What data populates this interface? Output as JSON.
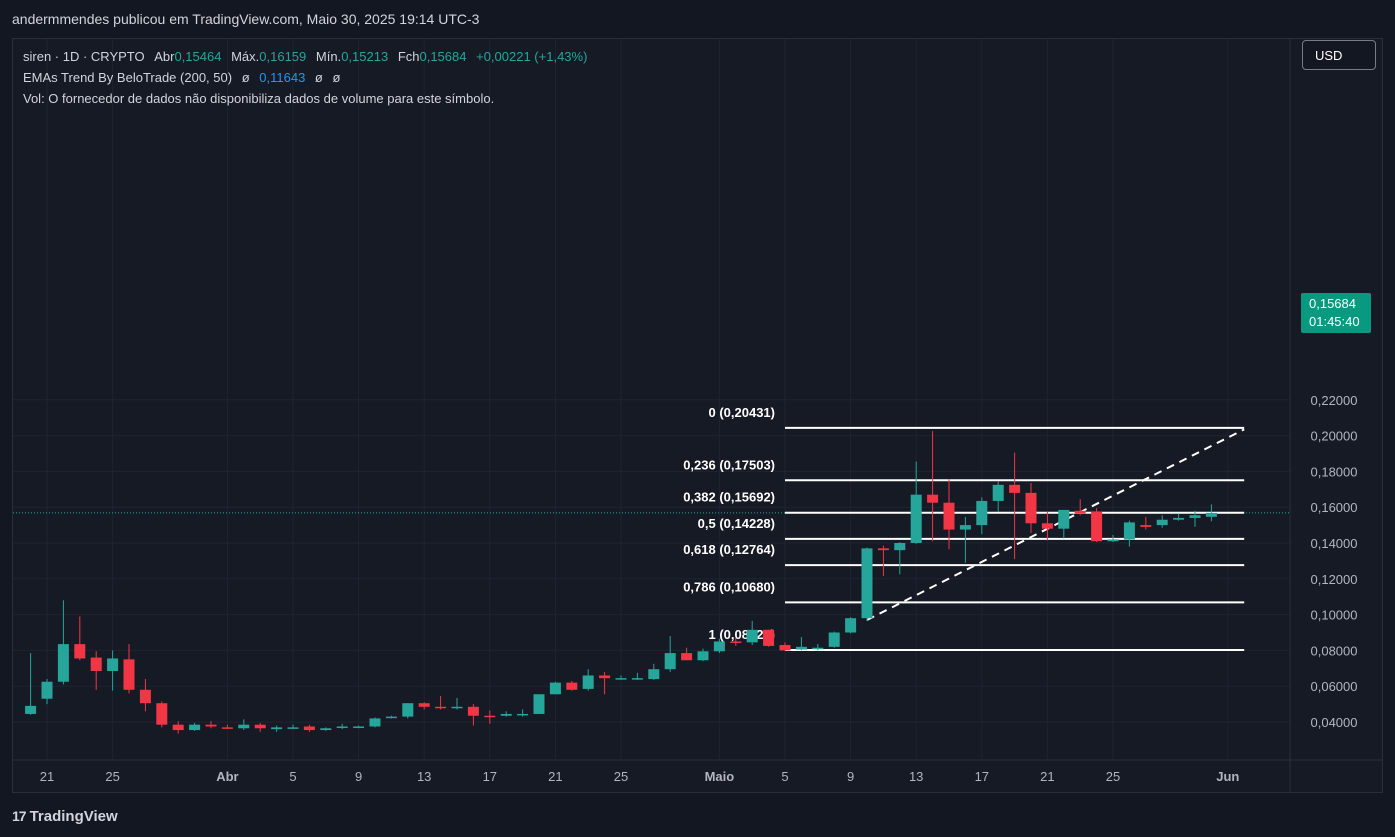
{
  "header": {
    "published_text": "andermmendes publicou em TradingView.com, Maio 30, 2025 19:14 UTC-3"
  },
  "legend": {
    "symbol": "siren · 1D · CRYPTO",
    "open_label": "Abr",
    "open": "0,15464",
    "high_label": "Máx.",
    "high": "0,16159",
    "low_label": "Mín.",
    "low": "0,15213",
    "close_label": "Fch",
    "close": "0,15684",
    "change": "+0,00221 (+1,43%)",
    "indicator_name": "EMAs Trend By BeloTrade (200, 50)",
    "indicator_null_1": "ø",
    "indicator_value": "0,11643",
    "indicator_null_2": "ø",
    "indicator_null_3": "ø",
    "volume_note": "Vol: O fornecedor de dados não disponibiliza dados de volume para este símbolo."
  },
  "currency_button": "USD",
  "price_badge": {
    "price": "0,15684",
    "countdown": "01:45:40"
  },
  "footer": {
    "logo_mark": "17",
    "logo_text": "TradingView"
  },
  "colors": {
    "background": "#161a25",
    "up": "#26a69a",
    "down": "#f23645",
    "grid": "#1f2430",
    "axis_text": "#b2b5be",
    "fib_line": "#ffffff"
  },
  "chart_data": {
    "type": "candlestick",
    "y_axis": {
      "range": [
        0.032,
        0.224
      ],
      "ticks": [
        "0,04000",
        "0,06000",
        "0,08000",
        "0,10000",
        "0,12000",
        "0,14000",
        "0,16000",
        "0,18000",
        "0,20000",
        "0,22000"
      ],
      "tick_values": [
        0.04,
        0.06,
        0.08,
        0.1,
        0.12,
        0.14,
        0.16,
        0.18,
        0.2,
        0.22
      ]
    },
    "x_axis": {
      "ticks": [
        "21",
        "25",
        "Abr",
        "5",
        "9",
        "13",
        "17",
        "21",
        "25",
        "Maio",
        "5",
        "9",
        "13",
        "17",
        "21",
        "25",
        "Jun"
      ],
      "tick_dates": [
        "2025-03-21",
        "2025-03-25",
        "2025-04-01",
        "2025-04-05",
        "2025-04-09",
        "2025-04-13",
        "2025-04-17",
        "2025-04-21",
        "2025-04-25",
        "2025-05-01",
        "2025-05-05",
        "2025-05-09",
        "2025-05-13",
        "2025-05-17",
        "2025-05-21",
        "2025-05-25",
        "2025-06-01"
      ]
    },
    "candles": [
      {
        "date": "2025-03-20",
        "o": 0.0445,
        "h": 0.0785,
        "l": 0.044,
        "c": 0.049
      },
      {
        "date": "2025-03-21",
        "o": 0.053,
        "h": 0.064,
        "l": 0.05,
        "c": 0.0625
      },
      {
        "date": "2025-03-22",
        "o": 0.0625,
        "h": 0.108,
        "l": 0.061,
        "c": 0.0835
      },
      {
        "date": "2025-03-23",
        "o": 0.0835,
        "h": 0.099,
        "l": 0.0745,
        "c": 0.0755
      },
      {
        "date": "2025-03-24",
        "o": 0.076,
        "h": 0.0795,
        "l": 0.058,
        "c": 0.0685
      },
      {
        "date": "2025-03-25",
        "o": 0.0685,
        "h": 0.08,
        "l": 0.0575,
        "c": 0.0755
      },
      {
        "date": "2025-03-26",
        "o": 0.075,
        "h": 0.0835,
        "l": 0.056,
        "c": 0.058
      },
      {
        "date": "2025-03-27",
        "o": 0.058,
        "h": 0.064,
        "l": 0.046,
        "c": 0.0505
      },
      {
        "date": "2025-03-28",
        "o": 0.0505,
        "h": 0.0515,
        "l": 0.037,
        "c": 0.0385
      },
      {
        "date": "2025-03-29",
        "o": 0.0385,
        "h": 0.0405,
        "l": 0.0335,
        "c": 0.0355
      },
      {
        "date": "2025-03-30",
        "o": 0.0355,
        "h": 0.0395,
        "l": 0.035,
        "c": 0.0385
      },
      {
        "date": "2025-03-31",
        "o": 0.0385,
        "h": 0.0405,
        "l": 0.0365,
        "c": 0.0375
      },
      {
        "date": "2025-04-01",
        "o": 0.037,
        "h": 0.0385,
        "l": 0.0365,
        "c": 0.0365
      },
      {
        "date": "2025-04-02",
        "o": 0.0365,
        "h": 0.0415,
        "l": 0.0355,
        "c": 0.0385
      },
      {
        "date": "2025-04-03",
        "o": 0.0385,
        "h": 0.0395,
        "l": 0.0345,
        "c": 0.0365
      },
      {
        "date": "2025-04-04",
        "o": 0.036,
        "h": 0.038,
        "l": 0.0345,
        "c": 0.037
      },
      {
        "date": "2025-04-05",
        "o": 0.037,
        "h": 0.0385,
        "l": 0.0365,
        "c": 0.037
      },
      {
        "date": "2025-04-06",
        "o": 0.0375,
        "h": 0.0385,
        "l": 0.0345,
        "c": 0.0355
      },
      {
        "date": "2025-04-07",
        "o": 0.0355,
        "h": 0.037,
        "l": 0.035,
        "c": 0.0365
      },
      {
        "date": "2025-04-08",
        "o": 0.037,
        "h": 0.039,
        "l": 0.036,
        "c": 0.0375
      },
      {
        "date": "2025-04-09",
        "o": 0.0375,
        "h": 0.038,
        "l": 0.0365,
        "c": 0.0375
      },
      {
        "date": "2025-04-10",
        "o": 0.0375,
        "h": 0.0425,
        "l": 0.037,
        "c": 0.042
      },
      {
        "date": "2025-04-11",
        "o": 0.0425,
        "h": 0.0435,
        "l": 0.042,
        "c": 0.043
      },
      {
        "date": "2025-04-12",
        "o": 0.043,
        "h": 0.0505,
        "l": 0.042,
        "c": 0.0505
      },
      {
        "date": "2025-04-13",
        "o": 0.0505,
        "h": 0.051,
        "l": 0.047,
        "c": 0.0485
      },
      {
        "date": "2025-04-14",
        "o": 0.0485,
        "h": 0.0545,
        "l": 0.047,
        "c": 0.048
      },
      {
        "date": "2025-04-15",
        "o": 0.048,
        "h": 0.0535,
        "l": 0.047,
        "c": 0.0485
      },
      {
        "date": "2025-04-16",
        "o": 0.0485,
        "h": 0.05,
        "l": 0.038,
        "c": 0.0435
      },
      {
        "date": "2025-04-17",
        "o": 0.0435,
        "h": 0.0465,
        "l": 0.039,
        "c": 0.043
      },
      {
        "date": "2025-04-18",
        "o": 0.0435,
        "h": 0.046,
        "l": 0.043,
        "c": 0.0445
      },
      {
        "date": "2025-04-19",
        "o": 0.0445,
        "h": 0.047,
        "l": 0.043,
        "c": 0.0445
      },
      {
        "date": "2025-04-20",
        "o": 0.0445,
        "h": 0.0555,
        "l": 0.0445,
        "c": 0.0555
      },
      {
        "date": "2025-04-21",
        "o": 0.0555,
        "h": 0.0625,
        "l": 0.0555,
        "c": 0.062
      },
      {
        "date": "2025-04-22",
        "o": 0.062,
        "h": 0.063,
        "l": 0.0575,
        "c": 0.058
      },
      {
        "date": "2025-04-23",
        "o": 0.0585,
        "h": 0.0695,
        "l": 0.0575,
        "c": 0.066
      },
      {
        "date": "2025-04-24",
        "o": 0.066,
        "h": 0.068,
        "l": 0.0555,
        "c": 0.0645
      },
      {
        "date": "2025-04-25",
        "o": 0.0645,
        "h": 0.066,
        "l": 0.0635,
        "c": 0.0645
      },
      {
        "date": "2025-04-26",
        "o": 0.0645,
        "h": 0.0675,
        "l": 0.0635,
        "c": 0.0645
      },
      {
        "date": "2025-04-27",
        "o": 0.064,
        "h": 0.0725,
        "l": 0.0635,
        "c": 0.0695
      },
      {
        "date": "2025-04-28",
        "o": 0.0695,
        "h": 0.088,
        "l": 0.068,
        "c": 0.0785
      },
      {
        "date": "2025-04-29",
        "o": 0.0785,
        "h": 0.0815,
        "l": 0.0745,
        "c": 0.0745
      },
      {
        "date": "2025-04-30",
        "o": 0.0745,
        "h": 0.081,
        "l": 0.074,
        "c": 0.0795
      },
      {
        "date": "2025-05-01",
        "o": 0.0795,
        "h": 0.0865,
        "l": 0.0785,
        "c": 0.085
      },
      {
        "date": "2025-05-02",
        "o": 0.085,
        "h": 0.087,
        "l": 0.0825,
        "c": 0.0845
      },
      {
        "date": "2025-05-03",
        "o": 0.0845,
        "h": 0.0965,
        "l": 0.083,
        "c": 0.0915
      },
      {
        "date": "2025-05-04",
        "o": 0.0915,
        "h": 0.0915,
        "l": 0.082,
        "c": 0.0825
      },
      {
        "date": "2025-05-05",
        "o": 0.083,
        "h": 0.0845,
        "l": 0.0795,
        "c": 0.08
      },
      {
        "date": "2025-05-06",
        "o": 0.0805,
        "h": 0.0875,
        "l": 0.08,
        "c": 0.082
      },
      {
        "date": "2025-05-07",
        "o": 0.081,
        "h": 0.0835,
        "l": 0.08,
        "c": 0.0815
      },
      {
        "date": "2025-05-08",
        "o": 0.082,
        "h": 0.0905,
        "l": 0.0815,
        "c": 0.09
      },
      {
        "date": "2025-05-09",
        "o": 0.09,
        "h": 0.0985,
        "l": 0.0895,
        "c": 0.098
      },
      {
        "date": "2025-05-10",
        "o": 0.098,
        "h": 0.1375,
        "l": 0.0965,
        "c": 0.137
      },
      {
        "date": "2025-05-11",
        "o": 0.137,
        "h": 0.1385,
        "l": 0.1215,
        "c": 0.136
      },
      {
        "date": "2025-05-12",
        "o": 0.136,
        "h": 0.1405,
        "l": 0.1225,
        "c": 0.14
      },
      {
        "date": "2025-05-13",
        "o": 0.14,
        "h": 0.1855,
        "l": 0.1395,
        "c": 0.167
      },
      {
        "date": "2025-05-14",
        "o": 0.167,
        "h": 0.2025,
        "l": 0.141,
        "c": 0.1625
      },
      {
        "date": "2025-05-15",
        "o": 0.1625,
        "h": 0.1755,
        "l": 0.1365,
        "c": 0.1475
      },
      {
        "date": "2025-05-16",
        "o": 0.1475,
        "h": 0.1545,
        "l": 0.129,
        "c": 0.15
      },
      {
        "date": "2025-05-17",
        "o": 0.15,
        "h": 0.1655,
        "l": 0.145,
        "c": 0.1635
      },
      {
        "date": "2025-05-18",
        "o": 0.1635,
        "h": 0.1745,
        "l": 0.1575,
        "c": 0.1725
      },
      {
        "date": "2025-05-19",
        "o": 0.1725,
        "h": 0.1905,
        "l": 0.131,
        "c": 0.168
      },
      {
        "date": "2025-05-20",
        "o": 0.168,
        "h": 0.1735,
        "l": 0.1455,
        "c": 0.151
      },
      {
        "date": "2025-05-21",
        "o": 0.151,
        "h": 0.1575,
        "l": 0.1415,
        "c": 0.148
      },
      {
        "date": "2025-05-22",
        "o": 0.148,
        "h": 0.158,
        "l": 0.1425,
        "c": 0.1585
      },
      {
        "date": "2025-05-23",
        "o": 0.158,
        "h": 0.1645,
        "l": 0.1555,
        "c": 0.1565
      },
      {
        "date": "2025-05-24",
        "o": 0.1575,
        "h": 0.1595,
        "l": 0.1405,
        "c": 0.141
      },
      {
        "date": "2025-05-25",
        "o": 0.141,
        "h": 0.1445,
        "l": 0.1405,
        "c": 0.142
      },
      {
        "date": "2025-05-26",
        "o": 0.142,
        "h": 0.1525,
        "l": 0.138,
        "c": 0.1515
      },
      {
        "date": "2025-05-27",
        "o": 0.15,
        "h": 0.1545,
        "l": 0.1475,
        "c": 0.149
      },
      {
        "date": "2025-05-28",
        "o": 0.15,
        "h": 0.1555,
        "l": 0.1485,
        "c": 0.153
      },
      {
        "date": "2025-05-29",
        "o": 0.153,
        "h": 0.1565,
        "l": 0.1525,
        "c": 0.154
      },
      {
        "date": "2025-05-30",
        "o": 0.154,
        "h": 0.158,
        "l": 0.149,
        "c": 0.1555
      },
      {
        "date": "2025-05-31",
        "o": 0.15464,
        "h": 0.16159,
        "l": 0.15213,
        "c": 0.15684
      }
    ],
    "current_price": 0.15684,
    "fibonacci": {
      "levels": [
        {
          "label": "0 (0,20431)",
          "ratio": 0,
          "price": 0.20431
        },
        {
          "label": "0,236 (0,17503)",
          "ratio": 0.236,
          "price": 0.17503
        },
        {
          "label": "0,382 (0,15692)",
          "ratio": 0.382,
          "price": 0.15692
        },
        {
          "label": "0,5 (0,14228)",
          "ratio": 0.5,
          "price": 0.14228
        },
        {
          "label": "0,618 (0,12764)",
          "ratio": 0.618,
          "price": 0.12764
        },
        {
          "label": "0,786 (0,10680)",
          "ratio": 0.786,
          "price": 0.1068
        },
        {
          "label": "1 (0,08025)",
          "ratio": 1,
          "price": 0.08025
        }
      ],
      "start_date": "2025-05-05",
      "end_date": "2025-06-02",
      "trend_from": {
        "date": "2025-05-10",
        "price": 0.097
      },
      "trend_to": {
        "date": "2025-06-02",
        "price": 0.2035
      }
    },
    "grid": true,
    "price_axis_side": "right"
  }
}
